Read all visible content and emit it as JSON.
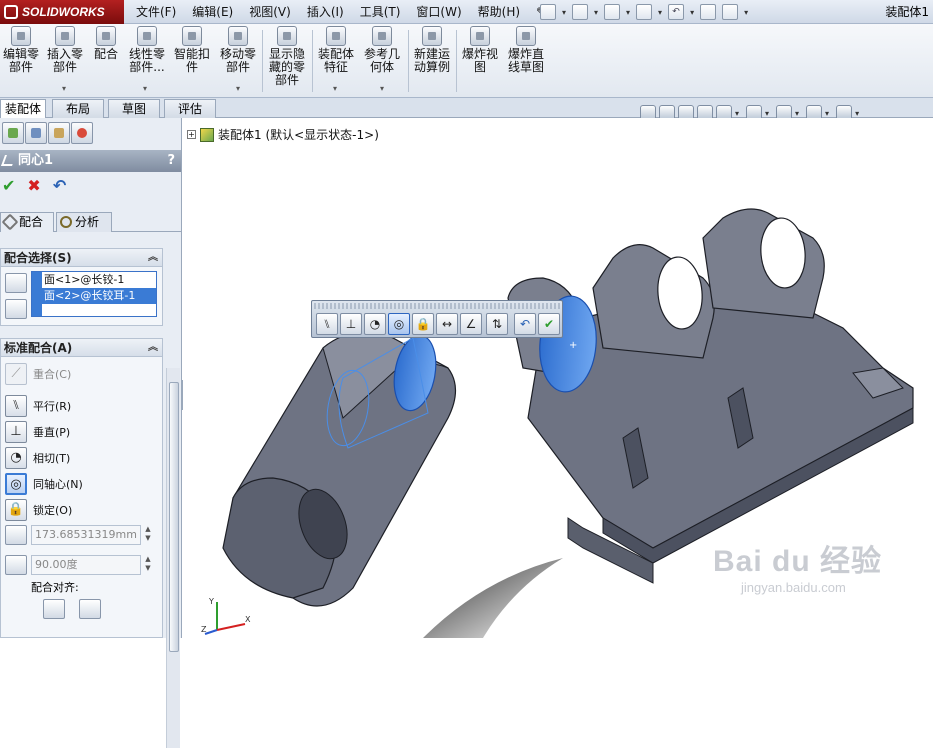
{
  "app": {
    "logo": "SOLIDWORKS",
    "document_title": "装配体1",
    "menu": [
      "文件(F)",
      "编辑(E)",
      "视图(V)",
      "插入(I)",
      "工具(T)",
      "窗口(W)",
      "帮助(H)"
    ]
  },
  "ribbon": {
    "buttons": [
      {
        "label": "编辑零\n部件",
        "icon": "edit-component-icon"
      },
      {
        "label": "插入零\n部件",
        "icon": "insert-component-icon"
      },
      {
        "label": "配合",
        "icon": "mate-icon"
      },
      {
        "label": "线性零\n部件...",
        "icon": "linear-pattern-icon"
      },
      {
        "label": "智能扣\n件",
        "icon": "smart-fastener-icon"
      },
      {
        "label": "移动零\n部件",
        "icon": "move-component-icon"
      },
      {
        "label": "显示隐\n藏的零\n部件",
        "icon": "show-hidden-icon"
      },
      {
        "label": "装配体\n特征",
        "icon": "assembly-feature-icon"
      },
      {
        "label": "参考几\n何体",
        "icon": "reference-geometry-icon"
      },
      {
        "label": "新建运\n动算例",
        "icon": "motion-study-icon"
      },
      {
        "label": "爆炸视\n图",
        "icon": "exploded-view-icon"
      },
      {
        "label": "爆炸直\n线草图",
        "icon": "explode-line-sketch-icon"
      }
    ]
  },
  "tabs": [
    "装配体",
    "布局",
    "草图",
    "评估"
  ],
  "tree": {
    "root": "装配体1  (默认<显示状态-1>)"
  },
  "property_manager": {
    "title": "同心1",
    "help": "?",
    "subtabs": [
      "配合",
      "分析"
    ],
    "selection_group": {
      "title": "配合选择(S)",
      "items": [
        "面<1>@长铰-1",
        "面<2>@长铰耳-1"
      ]
    },
    "standard_group": {
      "title": "标准配合(A)",
      "mates": [
        {
          "label": "重合(C)",
          "state": "disabled"
        },
        {
          "label": "平行(R)",
          "state": "normal"
        },
        {
          "label": "垂直(P)",
          "state": "normal"
        },
        {
          "label": "相切(T)",
          "state": "normal"
        },
        {
          "label": "同轴心(N)",
          "state": "selected"
        },
        {
          "label": "锁定(O)",
          "state": "normal"
        }
      ],
      "distance_value": "173.68531319mm",
      "angle_value": "90.00度",
      "alignment_label": "配合对齐:"
    }
  },
  "watermark": {
    "main": "Bai du 经验",
    "sub": "jingyan.baidu.com"
  },
  "triad": {
    "x": "X",
    "y": "Y",
    "z": "Z"
  },
  "colors": {
    "part": "#6e7383",
    "part_dark": "#4c5160",
    "highlight": "#3a7bd5"
  }
}
